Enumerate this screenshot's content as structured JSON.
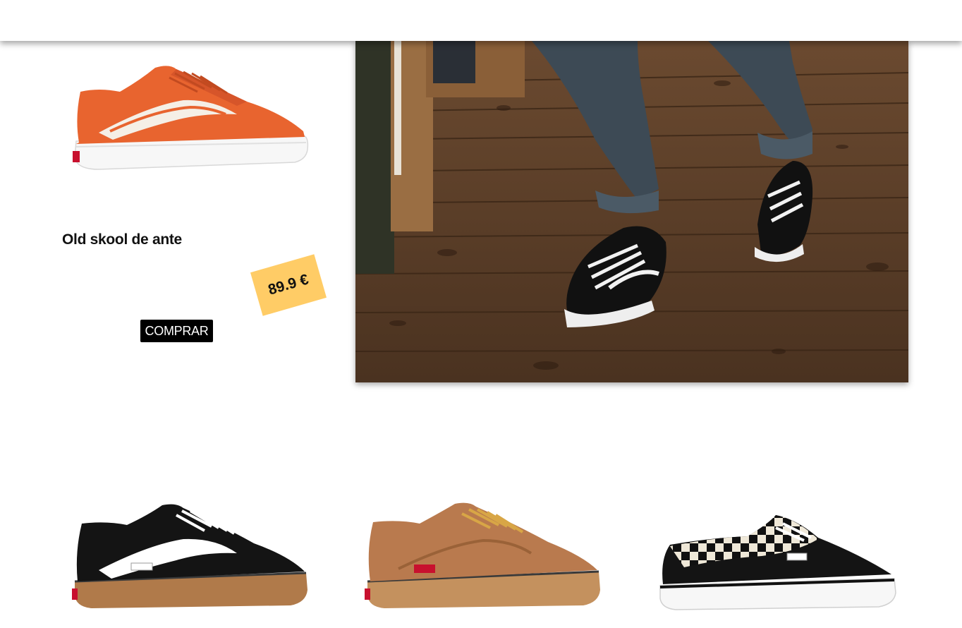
{
  "featured": {
    "name": "Old skool de ante",
    "price": "89.9 €",
    "buy_label": "COMPRAR",
    "shoe_color": "#e8642f"
  },
  "colors": {
    "price_tag": "#ffcc66",
    "button_bg": "#000000",
    "button_text": "#ffffff"
  },
  "grid_products": [
    {
      "icon": "black-gum-sneaker-image"
    },
    {
      "icon": "tan-suede-sneaker-image"
    },
    {
      "icon": "checkerboard-sneaker-image"
    }
  ]
}
